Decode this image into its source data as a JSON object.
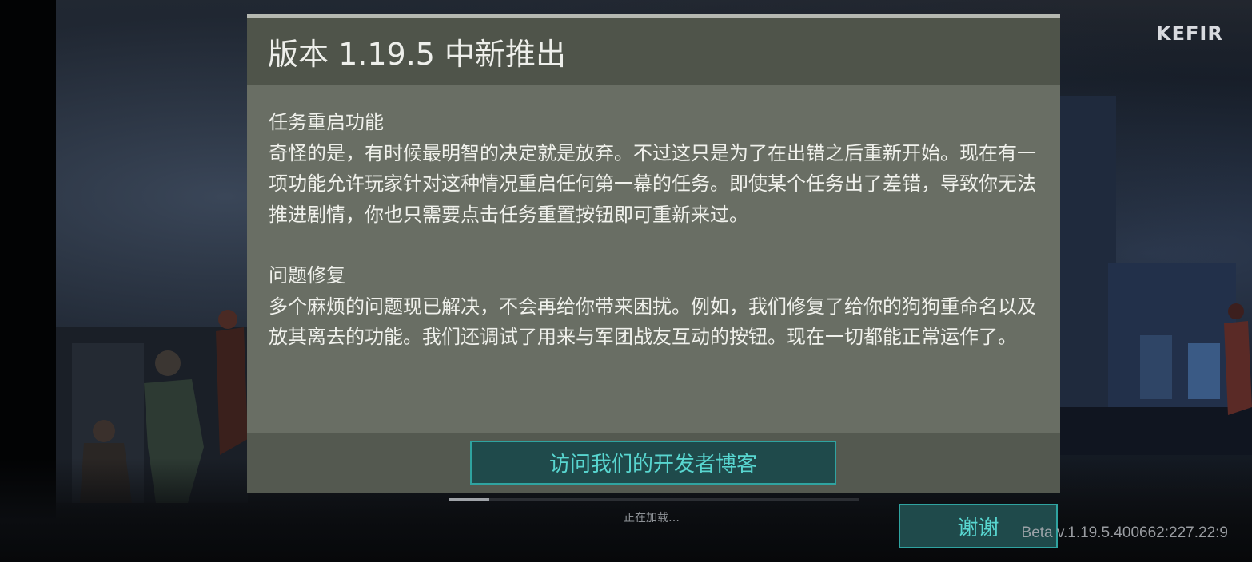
{
  "branding": {
    "logo_text": "KEFIR"
  },
  "dialog": {
    "title": "版本 1.19.5 中新推出",
    "sections": [
      {
        "heading": "任务重启功能",
        "text": "奇怪的是，有时候最明智的决定就是放弃。不过这只是为了在出错之后重新开始。现在有一项功能允许玩家针对这种情况重启任何第一幕的任务。即使某个任务出了差错，导致你无法推进剧情，你也只需要点击任务重置按钮即可重新来过。"
      },
      {
        "heading": "问题修复",
        "text": "多个麻烦的问题现已解决，不会再给你带来困扰。例如，我们修复了给你的狗狗重命名以及放其离去的功能。我们还调试了用来与军团战友互动的按钮。现在一切都能正常运作了。"
      }
    ],
    "blog_button_label": "访问我们的开发者博客"
  },
  "loading": {
    "text": "正在加载…",
    "progress": 0.1
  },
  "thanks_button_label": "谢谢",
  "version_text": "Beta v.1.19.5.400662:227.22:9",
  "colors": {
    "dialog_body": "#696e64",
    "dialog_header": "#4f544a",
    "button_bg": "#1f4a4b",
    "button_border": "#2fa3a0",
    "button_text": "#58d6d0"
  }
}
